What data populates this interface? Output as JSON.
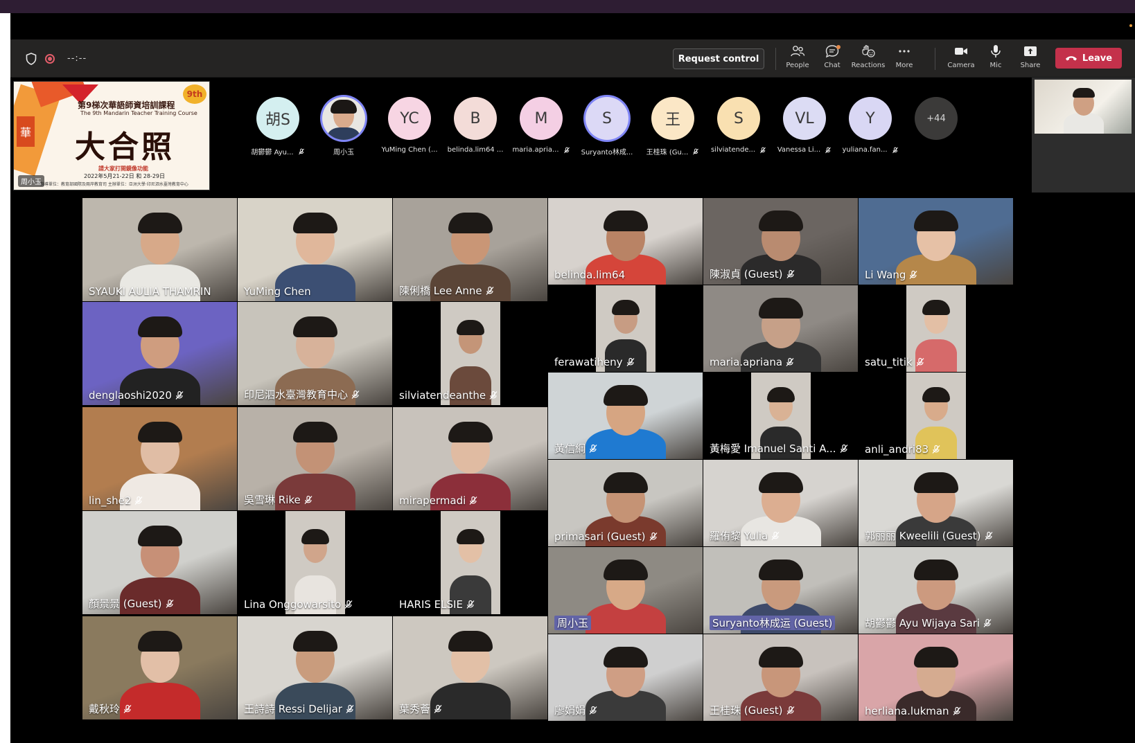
{
  "window": {
    "timer": "--:--"
  },
  "toolbar": {
    "request_control": "Request control",
    "people": "People",
    "chat": "Chat",
    "reactions": "Reactions",
    "more": "More",
    "camera": "Camera",
    "mic": "Mic",
    "share": "Share",
    "leave": "Leave",
    "icons": [
      "shield-icon",
      "record-icon",
      "people-icon",
      "chat-icon",
      "reactions-icon",
      "more-icon",
      "camera-icon",
      "mic-icon",
      "share-icon",
      "phone-icon"
    ]
  },
  "content_share": {
    "badge": "9th",
    "title_cn": "第9梯次華語師資培訓課程",
    "title_en": "The 9th Mandarin Teacher Training Course",
    "big_title": "大合照",
    "subtitle": "請大家打開鏡像功能",
    "dates": "2022年5月21-22日 和 28-29日",
    "fine_print": "指導單位：教育部國際及兩岸教育司    主辦單位：亞洲大學·印尼泗水臺灣教育中心",
    "side_char": "華",
    "presenter": "周小玉"
  },
  "strip_avatars": [
    {
      "initials": "胡S",
      "name": "胡鬱鬱 Ayu...",
      "color": "#d4eff0",
      "muted": true
    },
    {
      "initials": "",
      "name": "周小玉",
      "color": "#b98d72",
      "muted": false,
      "photo": true,
      "selected": true
    },
    {
      "initials": "YC",
      "name": "YuMing Chen (...",
      "color": "#f7d5e3",
      "muted": false
    },
    {
      "initials": "B",
      "name": "belinda.lim64 ...",
      "color": "#f3dcd8",
      "muted": false
    },
    {
      "initials": "M",
      "name": "maria.apria...",
      "color": "#f4cfe4",
      "muted": true
    },
    {
      "initials": "S",
      "name": "Suryanto林成...",
      "color": "#dcd9f6",
      "muted": false,
      "selected": true
    },
    {
      "initials": "王",
      "name": "王桂珠 (Gu...",
      "color": "#fbe7c6",
      "muted": true
    },
    {
      "initials": "S",
      "name": "silviatende...",
      "color": "#f9e0b1",
      "muted": true
    },
    {
      "initials": "VL",
      "name": "Vanessa Li...",
      "color": "#dcdcf4",
      "muted": true
    },
    {
      "initials": "Y",
      "name": "yuliana.fan...",
      "color": "#d9d7f4",
      "muted": true
    }
  ],
  "overflow_count": "+44",
  "participants": [
    {
      "name": "SYAUKI AULIA THAMRIN",
      "muted": false,
      "bg": "#bdb7ad",
      "skin": "#d7a989",
      "shirt": "#e9e8e3"
    },
    {
      "name": "YuMing Chen",
      "muted": false,
      "bg": "#d8d3c8",
      "skin": "#e0b79b",
      "shirt": "#3c4f73"
    },
    {
      "name": "陳俐橋 Lee Anne",
      "muted": true,
      "bg": "#a8a29a",
      "skin": "#c99676",
      "shirt": "#5b4537"
    },
    {
      "name": "belinda.lim64",
      "muted": false,
      "bg": "#d7d2cd",
      "skin": "#b98365",
      "shirt": "#d5453a"
    },
    {
      "name": "陳淑貞 (Guest)",
      "muted": true,
      "bg": "#6b6561",
      "skin": "#b98b70",
      "shirt": "#2b2a2a"
    },
    {
      "name": "Li Wang",
      "muted": true,
      "bg": "#4f6c92",
      "skin": "#e6c1a6",
      "shirt": "#b5874a"
    },
    {
      "name": "denglaoshi2020",
      "muted": true,
      "bg": "#6c63c2",
      "skin": "#cf9d7f",
      "shirt": "#222"
    },
    {
      "name": "印尼泗水臺灣教育中心",
      "muted": true,
      "bg": "#c8c4bb",
      "skin": "#d7b29a",
      "shirt": "#8c6b52"
    },
    {
      "name": "silviatendeanthe",
      "muted": true,
      "bg": "#000",
      "skin": "#c49578",
      "shirt": "#6b4a3c"
    },
    {
      "name": "ferawatiheny",
      "muted": true,
      "bg": "#000",
      "skin": "#c79c83",
      "shirt": "#2a2a2a"
    },
    {
      "name": "maria.apriana",
      "muted": true,
      "bg": "#8f8a85",
      "skin": "#c6a088",
      "shirt": "#333"
    },
    {
      "name": "satu_titik",
      "muted": true,
      "bg": "#000",
      "skin": "#e3bfa5",
      "shirt": "#d66a6a"
    },
    {
      "name": "lin_she2",
      "muted": true,
      "bg": "#b27d4f",
      "skin": "#e0bda5",
      "shirt": "#efe9e3"
    },
    {
      "name": "吳雪琳 Rike",
      "muted": true,
      "bg": "#b8b1a8",
      "skin": "#c39276",
      "shirt": "#7a3a3a"
    },
    {
      "name": "mirapermadi",
      "muted": true,
      "bg": "#c8c2bb",
      "skin": "#e0bba2",
      "shirt": "#8c2f3a"
    },
    {
      "name": "黃信綱",
      "muted": true,
      "bg": "#cfd4d6",
      "skin": "#d6a582",
      "shirt": "#1f7ad1"
    },
    {
      "name": "黃梅愛 Imanuel Santi A...",
      "muted": true,
      "bg": "#000",
      "skin": "#d9b295",
      "shirt": "#2a2a2a"
    },
    {
      "name": "anli_andri83",
      "muted": true,
      "bg": "#000",
      "skin": "#d8ab8b",
      "shirt": "#e0c35a"
    },
    {
      "name": "顏景景 (Guest)",
      "muted": true,
      "bg": "#d0d0cc",
      "skin": "#c79077",
      "shirt": "#6a2b2b"
    },
    {
      "name": "Lina Onggowarsito",
      "muted": true,
      "bg": "#000",
      "skin": "#d0a58b",
      "shirt": "#e8e4df"
    },
    {
      "name": "HARIS ELSIE",
      "muted": true,
      "bg": "#000",
      "skin": "#e3c0a6",
      "shirt": "#3a3a3a"
    },
    {
      "name": "primasari (Guest)",
      "muted": true,
      "bg": "#c8c6c1",
      "skin": "#c59375",
      "shirt": "#7a3a2d"
    },
    {
      "name": "羅侑黎 Yulia",
      "muted": true,
      "bg": "#d6d3cf",
      "skin": "#dcae91",
      "shirt": "#e8e6e2"
    },
    {
      "name": "郭丽丽 Kweelili (Guest)",
      "muted": true,
      "bg": "#d9d8d4",
      "skin": "#d6a588",
      "shirt": "#3a3a3a"
    },
    {
      "name": "周小玉",
      "muted": false,
      "active": true,
      "bg": "#8e8a83",
      "skin": "#d7a987",
      "shirt": "#c44040"
    },
    {
      "name": "Suryanto林成运 (Guest)",
      "muted": false,
      "active": true,
      "bg": "#c1bfba",
      "skin": "#c99a7d",
      "shirt": "#3e4a6a"
    },
    {
      "name": "胡鬱鬱 Ayu Wijaya Sari",
      "muted": true,
      "bg": "#cfcfcb",
      "skin": "#cc9a7f",
      "shirt": "#5a3a40"
    },
    {
      "name": "戴秋玲",
      "muted": true,
      "bg": "#8a7a5e",
      "skin": "#e2bfa7",
      "shirt": "#c42b2b"
    },
    {
      "name": "王詩詩 Ressi Delijar",
      "muted": true,
      "bg": "#d8d5cf",
      "skin": "#c99c7d",
      "shirt": "#3a4a5a"
    },
    {
      "name": "葉秀薈",
      "muted": true,
      "bg": "#cdc8c0",
      "skin": "#e2c0a7",
      "shirt": "#2a2a2a"
    },
    {
      "name": "廖娟娟",
      "muted": true,
      "bg": "#cfcfcf",
      "skin": "#cf9e84",
      "shirt": "#3a3a3a"
    },
    {
      "name": "王桂珠 (Guest)",
      "muted": true,
      "bg": "#c8c2bd",
      "skin": "#c8967a",
      "shirt": "#7a3a3a"
    },
    {
      "name": "herliana.lukman",
      "muted": true,
      "bg": "#d9a5a8",
      "skin": "#d5ab90",
      "shirt": "#3a2a2a"
    }
  ],
  "colors": {
    "leave": "#c4314b",
    "toolbar_bg": "#252423",
    "active_speaker": "#6264a7",
    "selected_ring": "#7f85f5"
  }
}
